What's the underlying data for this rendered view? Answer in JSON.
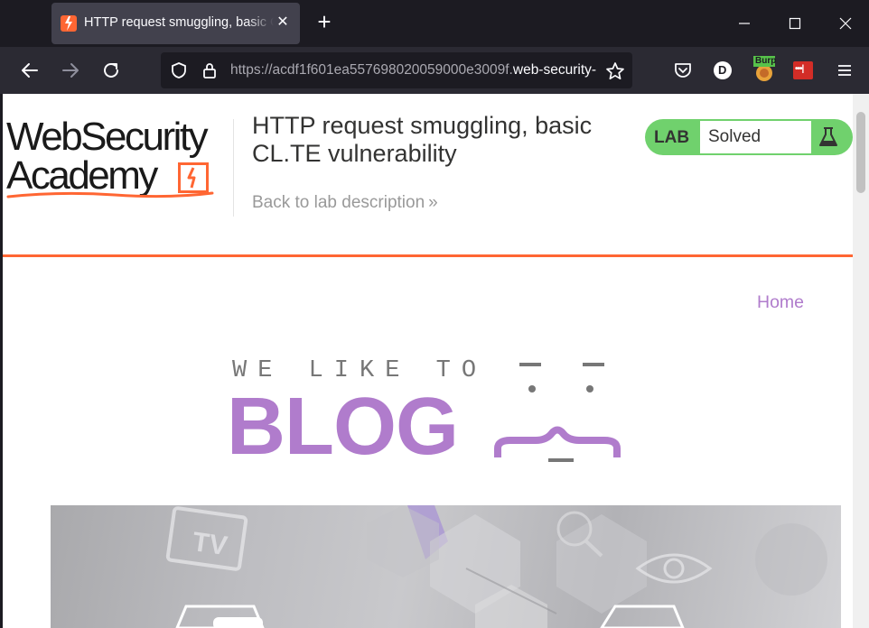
{
  "browser": {
    "tab_title": "HTTP request smuggling, basic CL.TE vulnerability",
    "new_tab_label": "+",
    "url_main": "https://acdf1f601ea557698020059000e3009f.",
    "url_host": "web-security-academy.net",
    "extensions": [
      "pocket-icon",
      "dark-reader-icon",
      "burp-icon",
      "lastpass-icon",
      "menu-icon"
    ],
    "burp_badge": "Burp",
    "dark_reader_letter": "D",
    "lastpass_badge": "•••|"
  },
  "header": {
    "logo_line1": "WebSecurity",
    "logo_line2": "Academy",
    "lab_title": "HTTP request smuggling, basic CL.TE vulnerability",
    "back_link": "Back to lab description",
    "back_chevron": "»",
    "lab_label": "LAB",
    "lab_status": "Solved",
    "lab_status_color": "#70d16d"
  },
  "nav": {
    "home": "Home"
  },
  "banner": {
    "small_text": "WE LIKE TO",
    "big_text": "BLOG"
  },
  "colors": {
    "accent_orange": "#ff6633",
    "accent_purple": "#b07ccc"
  }
}
